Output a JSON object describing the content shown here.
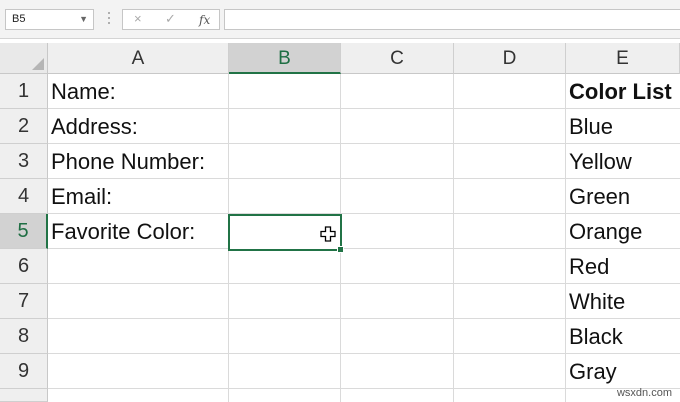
{
  "formula_bar": {
    "name_box": "B5",
    "cancel_symbol": "×",
    "enter_symbol": "✓",
    "fx_symbol": "fx",
    "formula_value": ""
  },
  "columns": [
    "A",
    "B",
    "C",
    "D",
    "E"
  ],
  "selected_column": "B",
  "rows": [
    "1",
    "2",
    "3",
    "4",
    "5",
    "6",
    "7",
    "8",
    "9"
  ],
  "selected_row": "5",
  "cells": {
    "A1": "Name:",
    "A2": "Address:",
    "A3": "Phone Number:",
    "A4": "Email:",
    "A5": "Favorite Color:",
    "E1": "Color List",
    "E2": "Blue",
    "E3": "Yellow",
    "E4": "Green",
    "E5": "Orange",
    "E6": "Red",
    "E7": "White",
    "E8": "Black",
    "E9": "Gray"
  },
  "active_cell": "B5",
  "colors": {
    "accent": "#217346",
    "header_bg": "#efefef",
    "selected_header_bg": "#d2d2d2"
  },
  "watermark": "wsxdn.com"
}
